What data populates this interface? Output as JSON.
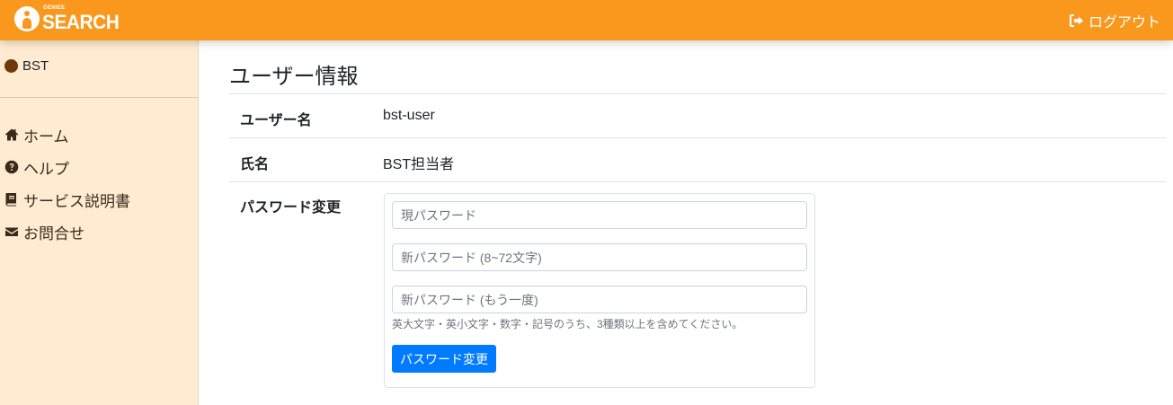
{
  "header": {
    "logo_small": "GENIEE",
    "logo_main": "SEARCH",
    "logout_label": "ログアウト",
    "logout_icon": "sign-out-icon",
    "background_color": "#fa981d"
  },
  "sidebar": {
    "user_name": "BST",
    "background_color": "#ffebd2",
    "items": [
      {
        "icon": "home-icon",
        "label": "ホーム"
      },
      {
        "icon": "question-circle-icon",
        "label": "ヘルプ"
      },
      {
        "icon": "book-icon",
        "label": "サービス説明書"
      },
      {
        "icon": "envelope-icon",
        "label": "お問合せ"
      }
    ]
  },
  "main": {
    "title": "ユーザー情報",
    "rows": [
      {
        "label": "ユーザー名",
        "value": "bst-user"
      },
      {
        "label": "氏名",
        "value": "BST担当者"
      }
    ],
    "password": {
      "label": "パスワード変更",
      "current_placeholder": "現パスワード",
      "current_value": "",
      "new_placeholder": "新パスワード (8~72文字)",
      "new_value": "",
      "confirm_placeholder": "新パスワード (もう一度)",
      "confirm_value": "",
      "hint": "英大文字・英小文字・数字・記号のうち、3種類以上を含めてください。",
      "button_label": "パスワード変更",
      "button_color": "#007bff"
    }
  }
}
